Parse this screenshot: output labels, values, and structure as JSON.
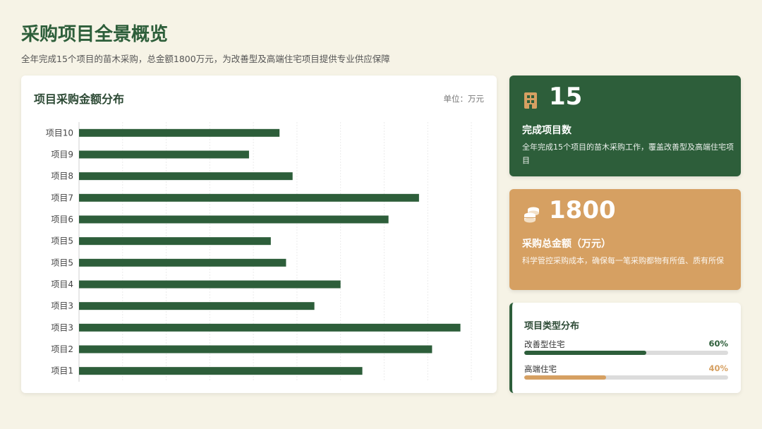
{
  "header": {
    "title": "采购项目全景概览",
    "subtitle": "全年完成15个项目的苗木采购，总金额1800万元，为改善型及高端住宅项目提供专业供应保障"
  },
  "chart_card": {
    "title": "项目采购金额分布",
    "unit": "单位：万元"
  },
  "chart_data": {
    "type": "bar",
    "orientation": "horizontal",
    "categories": [
      "项目1",
      "项目2",
      "项目3",
      "项目3",
      "项目4",
      "项目5",
      "项目5",
      "项目6",
      "项目7",
      "项目8",
      "项目9",
      "项目10"
    ],
    "values": [
      130,
      162,
      175,
      108,
      120,
      95,
      88,
      142,
      156,
      98,
      78,
      92
    ],
    "xlim": [
      0,
      180
    ],
    "grid": true,
    "color": "#2d5e3a"
  },
  "stats": {
    "projects": {
      "number": "15",
      "label": "完成项目数",
      "desc": "全年完成15个项目的苗木采购工作，覆盖改善型及高端住宅项目",
      "icon": "building-icon",
      "color": "#2d5e3a"
    },
    "amount": {
      "number": "1800",
      "label": "采购总金额（万元）",
      "desc": "科学管控采购成本，确保每一笔采购都物有所值、质有所保",
      "icon": "coins-icon",
      "color": "#d6a062"
    }
  },
  "types": {
    "title": "项目类型分布",
    "items": [
      {
        "name": "改善型住宅",
        "pct": "60%",
        "value": 0.6,
        "color": "#2d5e3a"
      },
      {
        "name": "高端住宅",
        "pct": "40%",
        "value": 0.4,
        "color": "#d6a062"
      }
    ]
  }
}
